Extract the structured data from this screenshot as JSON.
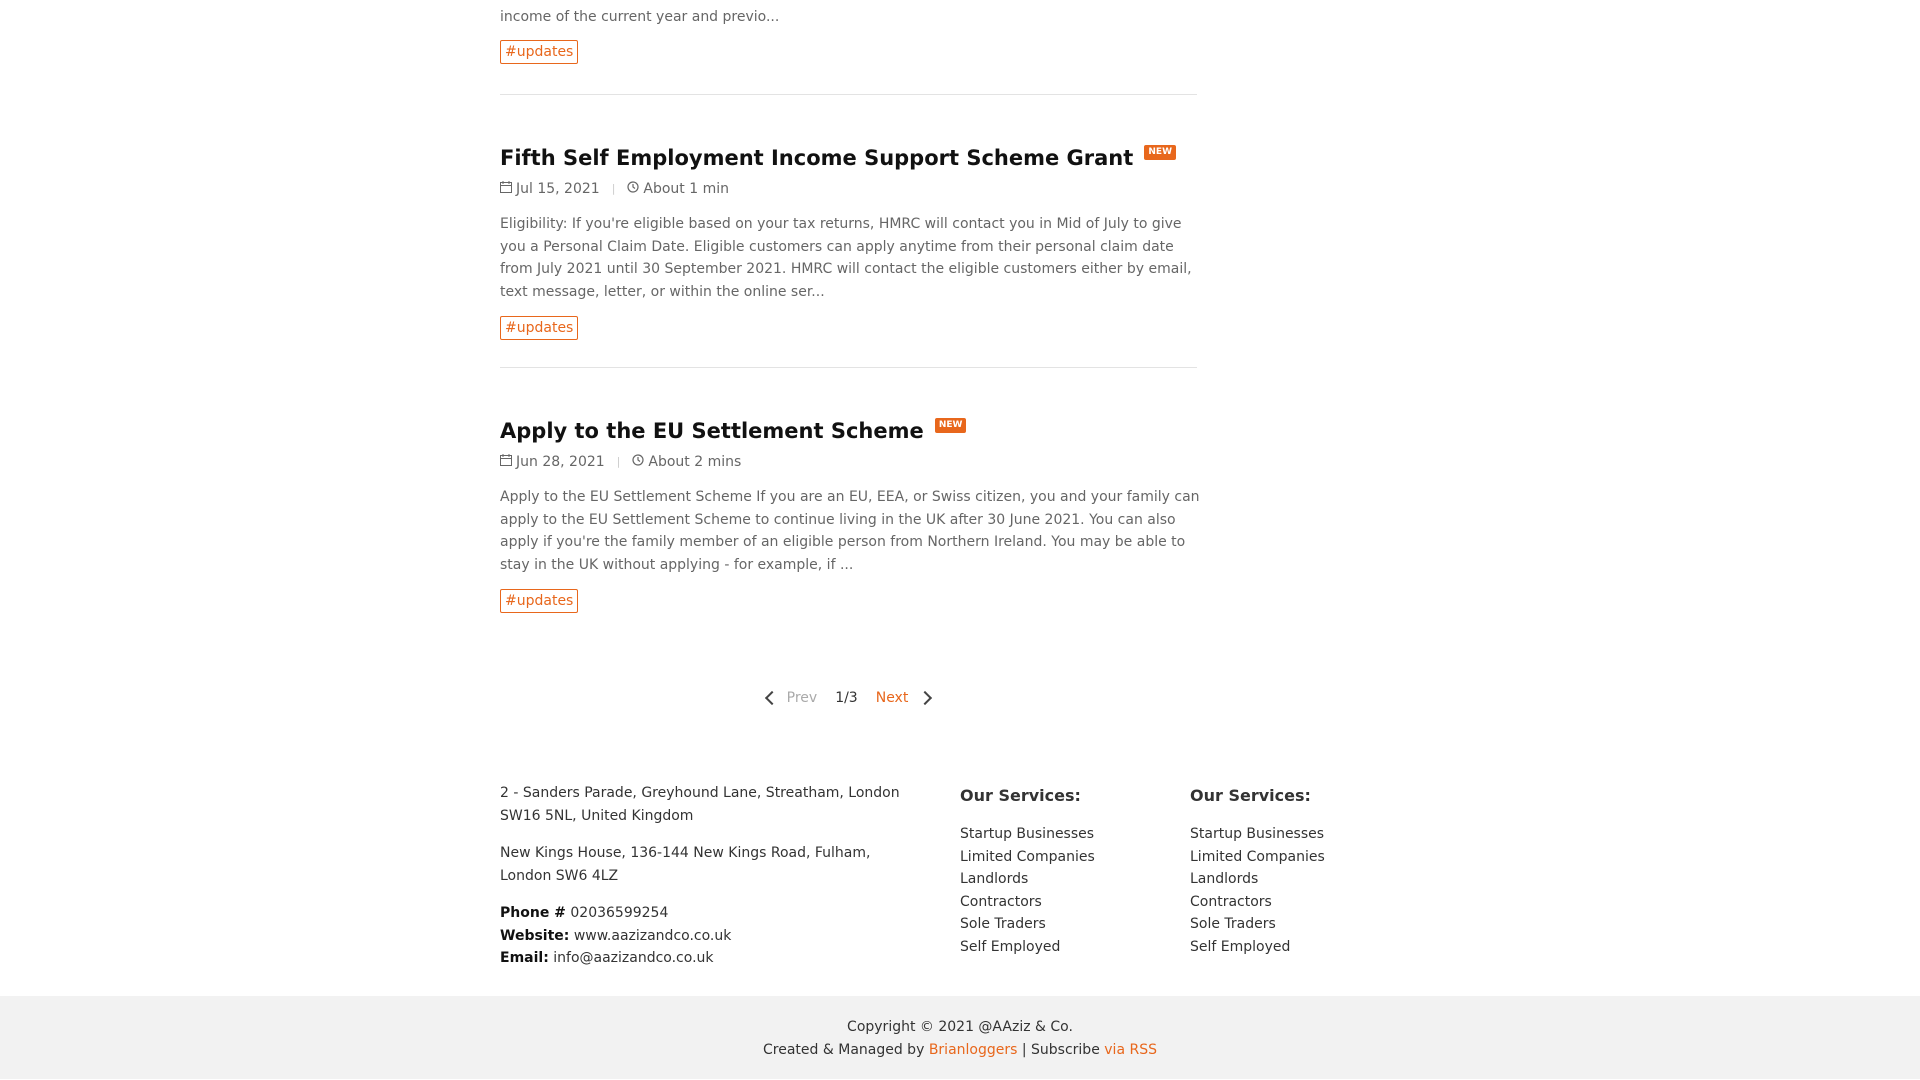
{
  "previous_post": {
    "excerpt_tail": "income of the current year and previo...",
    "tag": "#updates"
  },
  "posts": [
    {
      "title": "Fifth Self Employment Income Support Scheme Grant",
      "badge": "NEW",
      "date": "Jul 15, 2021",
      "read_time": "About 1 min",
      "excerpt": "Eligibility: If you're eligible based on your tax returns, HMRC will contact you in Mid of July to give you a Personal Claim Date. Eligible customers can apply anytime from their personal claim date from July 2021 until 30 September 2021. HMRC will contact the eligible customers either by email, text message, letter, or within the online ser...",
      "tag": "#updates"
    },
    {
      "title": "Apply to the EU Settlement Scheme",
      "badge": "NEW",
      "date": "Jun 28, 2021",
      "read_time": "About 2 mins",
      "excerpt": "Apply to the EU Settlement Scheme If you are an EU, EEA, or Swiss citizen, you and your family can apply to the EU Settlement Scheme to continue living in the UK after 30 June 2021. You can also apply if you're the family member of an eligible person from Northern Ireland. You may be able to stay in the UK without applying - for example, if ...",
      "tag": "#updates"
    }
  ],
  "pagination": {
    "prev": "Prev",
    "page": "1/3",
    "next": "Next"
  },
  "footer": {
    "address1": "2 - Sanders Parade, Greyhound Lane, Streatham, London SW16 5NL, United Kingdom",
    "address2": "New Kings House, 136-144 New Kings Road, Fulham, London SW6 4LZ",
    "phone_label": "Phone #",
    "phone": "02036599254",
    "website_label": "Website:",
    "website": "www.aazizandco.co.uk",
    "email_label": "Email:",
    "email": "info@aazizandco.co.uk",
    "services": [
      {
        "heading": "Our Services:",
        "items": [
          "Startup Businesses",
          "Limited Companies",
          "Landlords",
          "Contractors",
          "Sole Traders",
          "Self Employed"
        ]
      },
      {
        "heading": "Our Services:",
        "items": [
          "Startup Businesses",
          "Limited Companies",
          "Landlords",
          "Contractors",
          "Sole Traders",
          "Self Employed"
        ]
      }
    ],
    "copyright": "Copyright © 2021 @AAziz & Co.",
    "created_prefix": "Created & Managed by",
    "created_by": "Brianloggers",
    "subscribe_prefix": "| Subscribe",
    "rss": "via RSS"
  },
  "colors": {
    "accent": "#e8671c",
    "footer_bg": "#f2f2f2",
    "text_muted": "#666666"
  }
}
